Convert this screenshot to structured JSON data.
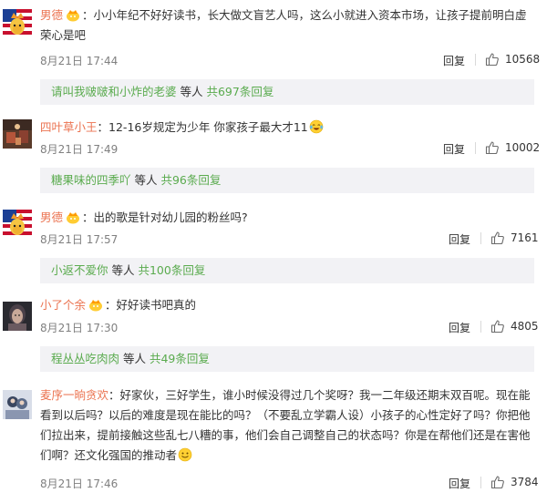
{
  "comments": [
    {
      "user": "男德",
      "text": "小小年纪不好好读书，长大做文盲艺人吗，这么小就进入资本市场，让孩子提前明白虚荣心是吧",
      "time": "8月21日 17:44",
      "reply": "回复",
      "likes": "10568",
      "sub_names": "请叫我啵啵和小炸的老婆",
      "sub_suffix": " 等人 ",
      "sub_count": "共697条回复"
    },
    {
      "user": "四叶草小王",
      "text": "12-16岁规定为少年 你家孩子最大才11",
      "time": "8月21日 17:49",
      "reply": "回复",
      "likes": "10002",
      "sub_names": "糖果味的四季吖",
      "sub_suffix": " 等人 ",
      "sub_count": "共96条回复"
    },
    {
      "user": "男德",
      "text": "出的歌是针对幼儿园的粉丝吗?",
      "time": "8月21日 17:57",
      "reply": "回复",
      "likes": "7161",
      "sub_names": "小返不爱你",
      "sub_suffix": " 等人 ",
      "sub_count": "共100条回复"
    },
    {
      "user": "小了个余",
      "text": "好好读书吧真的",
      "time": "8月21日 17:30",
      "reply": "回复",
      "likes": "4805",
      "sub_names": "程丛丛吃肉肉",
      "sub_suffix": " 等人 ",
      "sub_count": "共49条回复"
    },
    {
      "user": "麦序一晌贪欢",
      "text": "好家伙，三好学生，谁小时候没得过几个奖呀？我一二年级还期末双百呢。现在能看到以后吗？以后的难度是现在能比的吗？（不要乱立学霸人设）小孩子的心性定好了吗？你把他们拉出来，提前接触这些乱七八糟的事，他们会自己调整自己的状态吗？你是在帮他们还是在害他们啊？还文化强国的推动者",
      "time": "8月21日 17:46",
      "reply": "回复",
      "likes": "3784"
    }
  ],
  "colors": {
    "username": "#eb7350",
    "sub_link": "#5aab4e",
    "meta_gray": "#808080",
    "sub_bg": "#f2f2f5"
  },
  "icons": {
    "vip_badge": "vip-crown-badge-icon",
    "like": "thumbs-up-icon",
    "laugh_cry_emoji": "laughing-tears-emoji-icon",
    "smile_emoji": "smile-emoji-icon"
  }
}
